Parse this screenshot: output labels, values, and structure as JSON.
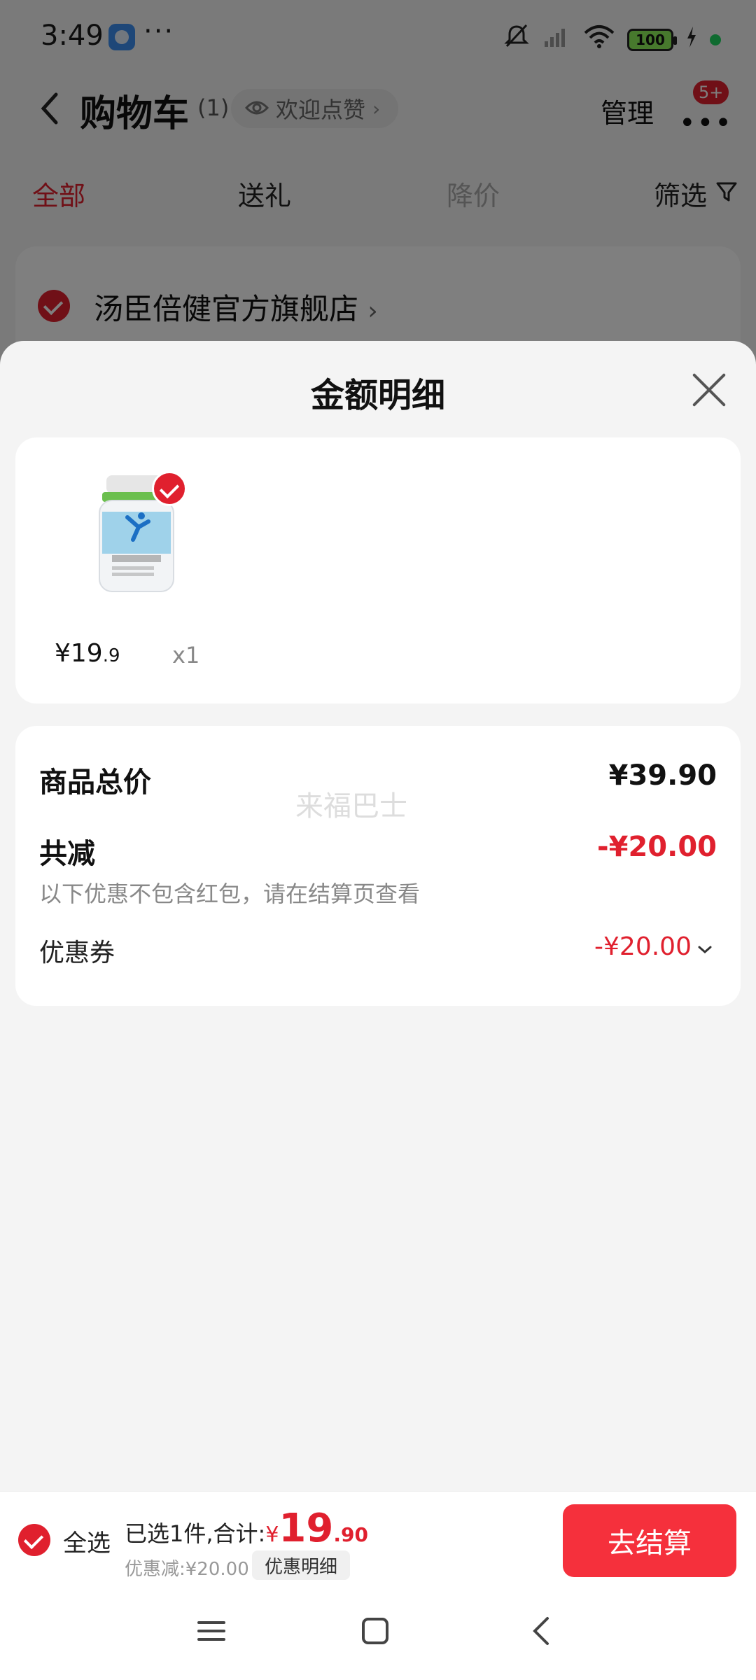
{
  "status_bar": {
    "time": "3:49",
    "dots": "···",
    "battery": "100"
  },
  "nav": {
    "title": "购物车",
    "count": "(1)",
    "like_text": "欢迎点赞",
    "manage": "管理",
    "badge": "5+"
  },
  "tabs": [
    {
      "label": "全部"
    },
    {
      "label": "送礼"
    },
    {
      "label": "降价"
    }
  ],
  "filter_label": "筛选",
  "store": {
    "name": "汤臣倍健官方旗舰店"
  },
  "sheet": {
    "title": "金额明细",
    "product": {
      "price_main": "¥19",
      "price_cents": ".9",
      "qty": "x1"
    },
    "summary": {
      "total_label": "商品总价",
      "total_value": "¥39.90",
      "discount_label": "共减",
      "discount_value": "-¥20.00",
      "note": "以下优惠不包含红包，请在结算页查看",
      "coupon_label": "优惠券",
      "coupon_value": "-¥20.00",
      "watermark": "来福巴士"
    }
  },
  "bottom": {
    "select_all": "全选",
    "selected_text": "已选1件,合计:",
    "currency": "¥",
    "total_int": "19",
    "total_cents": ".90",
    "discount_text": "优惠减:¥20.00",
    "detail_label": "优惠明细",
    "checkout_label": "去结算"
  },
  "colors": {
    "accent": "#e0202e",
    "checkout": "#f5303c"
  }
}
